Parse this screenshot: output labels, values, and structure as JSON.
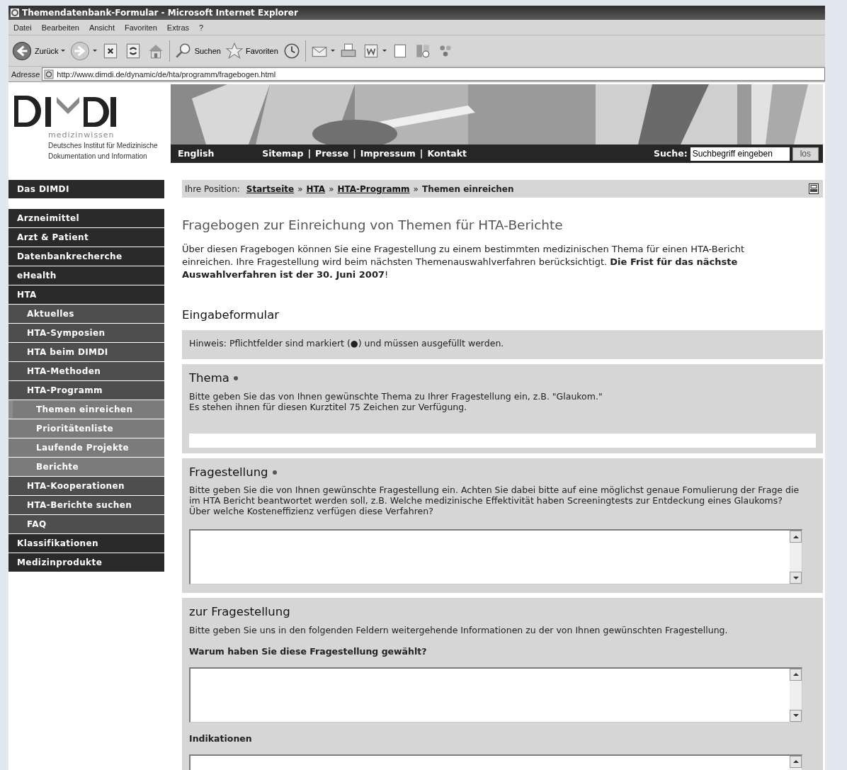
{
  "window": {
    "title": "Themendatenbank-Formular - Microsoft Internet Explorer"
  },
  "menu": [
    "Datei",
    "Bearbeiten",
    "Ansicht",
    "Favoriten",
    "Extras",
    "?"
  ],
  "toolbar": [
    {
      "kind": "back",
      "label": "Zurück",
      "dropdown": true
    },
    {
      "kind": "forward",
      "dropdown": true
    },
    {
      "kind": "stop"
    },
    {
      "kind": "refresh"
    },
    {
      "kind": "home"
    },
    {
      "kind": "search",
      "label": "Suchen"
    },
    {
      "kind": "favorites",
      "label": "Favoriten"
    },
    {
      "kind": "history"
    },
    {
      "kind": "mail",
      "dropdown": true
    },
    {
      "kind": "print"
    },
    {
      "kind": "word",
      "dropdown": true
    },
    {
      "kind": "blank"
    },
    {
      "kind": "research"
    },
    {
      "kind": "messenger"
    }
  ],
  "address": {
    "label": "Adresse",
    "url": "http://www.dimdi.de/dynamic/de/hta/programm/fragebogen.html"
  },
  "logo": {
    "tagline": "medizinwissen",
    "name_lines": [
      "Deutsches Institut für Medizinische",
      "Dokumentation und Information"
    ]
  },
  "topnav": {
    "language": "English",
    "links": [
      "Sitemap",
      "Presse",
      "Impressum",
      "Kontakt"
    ],
    "separator": "|",
    "search_label": "Suche:",
    "search_value": "Suchbegriff eingeben",
    "search_button": "los"
  },
  "sidebar": {
    "header": "Das DIMDI",
    "items": [
      {
        "label": "Arzneimittel",
        "selected": false
      },
      {
        "label": "Arzt & Patient",
        "selected": false
      },
      {
        "label": "Datenbankrecherche",
        "selected": false
      },
      {
        "label": "eHealth",
        "selected": false
      },
      {
        "label": "HTA",
        "selected": false,
        "children": [
          {
            "label": "Aktuelles",
            "selected": false
          },
          {
            "label": "HTA-Symposien",
            "selected": false
          },
          {
            "label": "HTA beim DIMDI",
            "selected": false
          },
          {
            "label": "HTA-Methoden",
            "selected": false
          },
          {
            "label": "HTA-Programm",
            "selected": false,
            "children": [
              {
                "label": "Themen einreichen",
                "selected": true
              },
              {
                "label": "Prioritätenliste",
                "selected": false
              },
              {
                "label": "Laufende Projekte",
                "selected": false
              },
              {
                "label": "Berichte",
                "selected": false
              }
            ]
          },
          {
            "label": "HTA-Kooperationen",
            "selected": false
          },
          {
            "label": "HTA-Berichte suchen",
            "selected": false
          },
          {
            "label": "FAQ",
            "selected": false
          }
        ]
      },
      {
        "label": "Klassifikationen",
        "selected": false
      },
      {
        "label": "Medizinprodukte",
        "selected": false
      }
    ]
  },
  "breadcrumb": {
    "label": "Ihre Position:",
    "separator": "»",
    "items": [
      {
        "text": "Startseite",
        "link": true
      },
      {
        "text": "HTA",
        "link": true
      },
      {
        "text": "HTA-Programm",
        "link": true
      },
      {
        "text": "Themen einreichen",
        "link": false
      }
    ]
  },
  "heading": "Fragebogen zur Einreichung von Themen für HTA-Berichte",
  "intro": "Über diesen Fragebogen können Sie eine Fragestellung zu einem bestimmten medizinischen Thema für einen HTA-Bericht einreichen. Ihre Fragestellung wird beim nächsten Themenauswahlverfahren berücksichtigt. **Die Frist für das nächste Auswahlverfahren ist der 30. Juni 2007**!",
  "form_heading": "Eingabeformular",
  "hint": "Hinweis: Pflichtfelder sind markiert (●) und müssen ausgefüllt werden.",
  "sections": [
    {
      "title": "Thema",
      "required": true,
      "description": [
        "Bitte geben Sie das von Ihnen gewünschte Thema zu Ihrer Fragestellung ein, z.B. \"Glaukom.\"",
        "Es stehen ihnen für diesen Kurztitel 75 Zeichen zur Verfügung."
      ],
      "fields": [
        {
          "kind": "text"
        }
      ]
    },
    {
      "title": "Fragestellung",
      "required": true,
      "description": [
        "Bitte geben Sie die von Ihnen gewünschte Fragestellung ein. Achten Sie dabei bitte auf eine möglichst genaue Fomulierung der Frage die im HTA Bericht beantwortet werden soll, z.B. Welche medizinische Effektivität haben Screeningtests zur Entdeckung eines Glaukoms? Über welche Kosteneffizienz verfügen diese Verfahren?"
      ],
      "fields": [
        {
          "kind": "textarea"
        }
      ]
    },
    {
      "title": "zur Fragestellung",
      "required": false,
      "description": [
        "Bitte geben Sie uns in den folgenden Feldern weitergehende Informationen zu der von Ihnen gewünschten Fragestellung."
      ],
      "fields": [
        {
          "kind": "textarea",
          "label": "Warum haben Sie diese Fragestellung gewählt?"
        },
        {
          "kind": "textarea",
          "label": "Indikationen"
        }
      ]
    }
  ]
}
